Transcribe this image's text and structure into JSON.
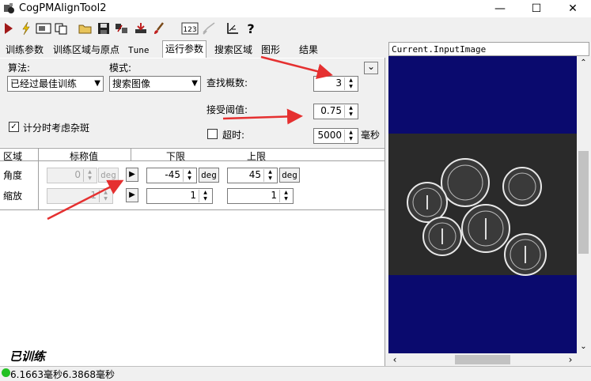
{
  "window": {
    "title": "CogPMAlignTool2",
    "minimize_glyph": "—",
    "maximize_glyph": "☐",
    "close_glyph": "✕"
  },
  "toolbar": {
    "icons": [
      "run-icon",
      "electric-icon",
      "show-image-icon",
      "copy-icon",
      "open-icon",
      "save-icon",
      "reset-icon",
      "import-icon",
      "brush-icon",
      "sequence-icon",
      "disabled-brush-icon",
      "measure-icon",
      "help-icon"
    ],
    "sequence_text": "123",
    "help_glyph": "?"
  },
  "tabs": [
    {
      "label": "训练参数",
      "active": false
    },
    {
      "label": "训练区域与原点",
      "active": false
    },
    {
      "label": "Tune",
      "active": false
    },
    {
      "label": "运行参数",
      "active": true
    },
    {
      "label": "搜索区域",
      "active": false
    },
    {
      "label": "图形",
      "active": false
    },
    {
      "label": "结果",
      "active": false
    }
  ],
  "run_params": {
    "algorithm_label": "算法:",
    "algorithm_value": "已经过最佳训练",
    "mode_label": "模式:",
    "mode_value": "搜索图像",
    "find_count_label": "查找概数:",
    "find_count_value": "3",
    "accept_threshold_label": "接受阈值:",
    "accept_threshold_value": "0.75",
    "timeout_checkbox_label": "超时:",
    "timeout_checked": false,
    "timeout_value": "5000",
    "timeout_unit": "毫秒",
    "clutter_label": "计分时考虑杂斑",
    "clutter_checked": true,
    "collapse_glyph": "⌄"
  },
  "zone_table": {
    "headers": [
      "区域",
      "标称值",
      "下限",
      "上限"
    ],
    "rows": [
      {
        "label": "角度",
        "nominal": "0",
        "nominal_unit": "deg",
        "low": "-45",
        "low_unit": "deg",
        "high": "45",
        "high_unit": "deg"
      },
      {
        "label": "缩放",
        "nominal": "1",
        "nominal_unit": "",
        "low": "1",
        "low_unit": "",
        "high": "1",
        "high_unit": ""
      }
    ]
  },
  "trained_status": "已训练",
  "status_bar": {
    "text": "6.1663毫秒6.3868毫秒",
    "indicator_color": "#22c022"
  },
  "image_view": {
    "title": "Current.InputImage",
    "background": "#0a0a6e"
  },
  "colors": {
    "arrow": "#e53030",
    "accent_tab": "#ffffff"
  }
}
